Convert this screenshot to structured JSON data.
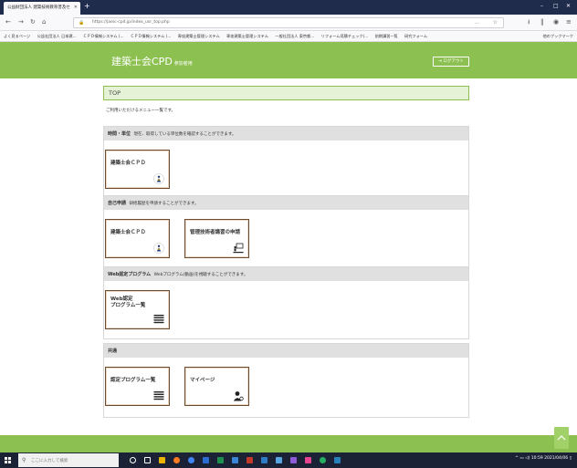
{
  "browser": {
    "tab_title": "公益財団法人 建築技術教育普及セ",
    "url": "https://jaeic-cpd.jp/index_usr_top.php",
    "bookmarks": [
      "よく見るページ",
      "公益社団法人 日本建...",
      "ＣＰＤ情報システム (...",
      "ＣＰＤ情報システム (...",
      "専攻建築士管理システム",
      "専攻建築士管理システム",
      "一般社団法人 東京都...",
      "リフォーム見積チェック(...",
      "前期講習一覧",
      "研究フォーム"
    ],
    "other_bookmarks": "他のブックマーク"
  },
  "header": {
    "title": "建築士会CPD",
    "subtitle": "参加者用",
    "logout": "ログアウト"
  },
  "page": {
    "title": "TOP",
    "intro": "ご利用いただけるメニュー一覧です。"
  },
  "sections": [
    {
      "heading": "時間・単位",
      "description": "現在、取得している単位数を確認することができます。",
      "cards": [
        {
          "label": "建築士会ＣＰＤ",
          "icon": "person-badge-icon"
        }
      ]
    },
    {
      "heading": "自己申請",
      "description": "研修履歴を申請することができます。",
      "cards": [
        {
          "label": "建築士会ＣＰＤ",
          "icon": "person-badge-icon"
        },
        {
          "label": "管理技術者講習の申請",
          "icon": "presentation-icon"
        }
      ]
    },
    {
      "heading": "Web認定プログラム",
      "description": "Webプログラム(動画)を視聴することができます。",
      "cards": [
        {
          "label": "Web認定\nプログラム一覧",
          "icon": "list-icon"
        }
      ]
    },
    {
      "heading": "共通",
      "description": "",
      "cards": [
        {
          "label": "認定プログラム一覧",
          "icon": "list-icon"
        },
        {
          "label": "マイページ",
          "icon": "user-gear-icon"
        }
      ]
    }
  ],
  "taskbar": {
    "search_placeholder": "ここに入力して検索",
    "time": "10:59",
    "date": "2021/04/06"
  },
  "colors": {
    "brand_green": "#8cc152",
    "card_border": "#6e4a2e",
    "title_bg": "#e6f2d6"
  }
}
